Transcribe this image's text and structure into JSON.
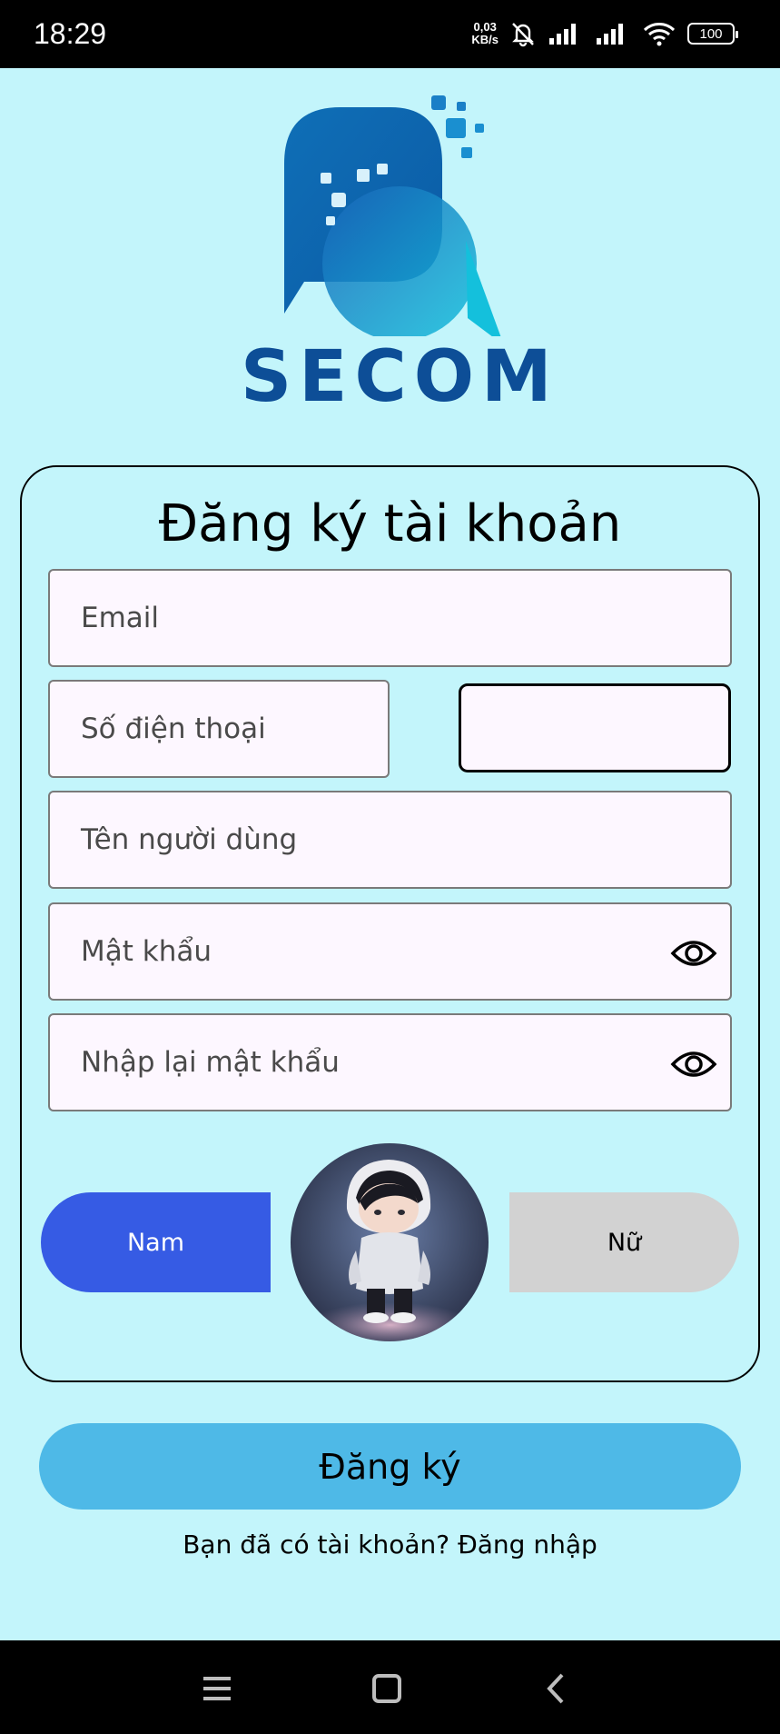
{
  "status_bar": {
    "time": "18:29",
    "net_speed_value": "0,03",
    "net_speed_unit": "KB/s",
    "battery": "100"
  },
  "logo": {
    "text": "SECOM",
    "color": "#0d4e97"
  },
  "form": {
    "title": "Đăng ký tài khoản",
    "email_placeholder": "Email",
    "phone_placeholder": "Số điện thoại",
    "country_code_value": "",
    "username_placeholder": "Tên người dùng",
    "password_placeholder": "Mật khẩu",
    "confirm_password_placeholder": "Nhập lại mật khẩu",
    "gender": {
      "male_label": "Nam",
      "female_label": "Nữ",
      "selected": "Nam"
    }
  },
  "register_button_label": "Đăng ký",
  "login_link_text": "Bạn đã có tài khoản? Đăng nhập",
  "colors": {
    "background": "#c3f5fb",
    "male_selected": "#365be4",
    "female_unselected": "#d2d2d2",
    "register_button": "#4eb9e7"
  },
  "nav": {
    "icons": [
      "menu-icon",
      "home-square-icon",
      "back-chevron-icon"
    ]
  }
}
